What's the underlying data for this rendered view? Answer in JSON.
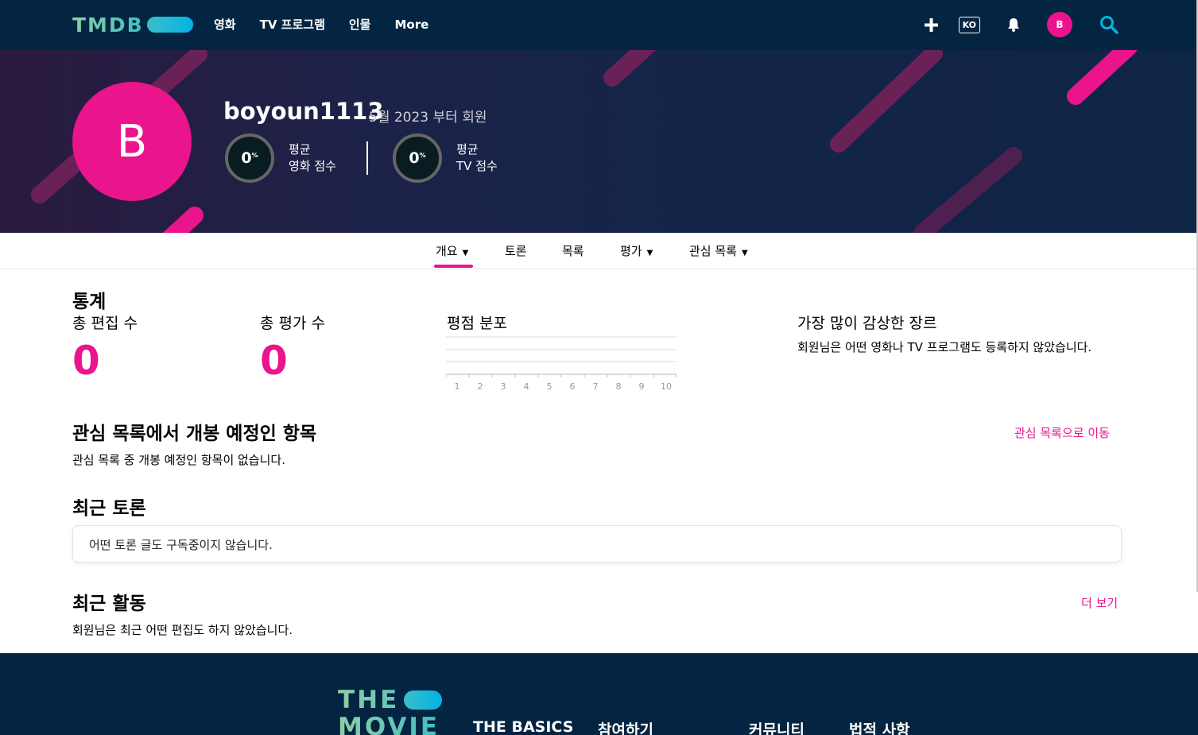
{
  "nav": {
    "logo": "TMDB",
    "links": [
      "영화",
      "TV 프로그램",
      "인물",
      "More"
    ],
    "add_icon": "plus-icon",
    "language": "KO",
    "bell_icon": "bell-icon",
    "avatar_letter": "B",
    "search_icon": "search-icon"
  },
  "profile": {
    "avatar_letter": "B",
    "username": "boyoun1113",
    "member_since": "5월 2023 부터 회원",
    "movie_score": {
      "value": "0",
      "unit": "%",
      "label_line1": "평균",
      "label_line2": "영화 점수"
    },
    "tv_score": {
      "value": "0",
      "unit": "%",
      "label_line1": "평균",
      "label_line2": "TV 점수"
    }
  },
  "tabs": [
    {
      "label": "개요",
      "dropdown": true,
      "active": true
    },
    {
      "label": "토론",
      "dropdown": false
    },
    {
      "label": "목록",
      "dropdown": false
    },
    {
      "label": "평가",
      "dropdown": true
    },
    {
      "label": "관심 목록",
      "dropdown": true
    }
  ],
  "stats": {
    "title": "통계",
    "total_edits_label": "총 편집 수",
    "total_edits_value": "0",
    "total_ratings_label": "총 평가 수",
    "total_ratings_value": "0",
    "rating_distribution_title": "평점 분포",
    "genre_title": "가장 많이 감상한 장르",
    "genre_text": "회원님은 어떤 영화나 TV 프로그램도 등록하지 않았습니다."
  },
  "chart_data": {
    "type": "bar",
    "title": "평점 분포",
    "categories": [
      "1",
      "2",
      "3",
      "4",
      "5",
      "6",
      "7",
      "8",
      "9",
      "10"
    ],
    "values": [
      0,
      0,
      0,
      0,
      0,
      0,
      0,
      0,
      0,
      0
    ],
    "grid": true
  },
  "upcoming": {
    "title": "관심 목록에서 개봉 예정인 항목",
    "text": "관심 목록 중 개봉 예정인 항목이 없습니다.",
    "link": "관심 목록으로 이동"
  },
  "discussions": {
    "title": "최근 토론",
    "text": "어떤 토론 글도 구독중이지 않습니다."
  },
  "activity": {
    "title": "최근 활동",
    "text": "회원님은 최근 어떤 편집도 하지 않았습니다.",
    "link": "더 보기"
  },
  "footer": {
    "logo_line1": "THE",
    "logo_line2": "MOVIE",
    "headings": [
      "THE BASICS",
      "참여하기",
      "커뮤니티",
      "법적 사항"
    ]
  },
  "colors": {
    "navy": "#032541",
    "pink": "#ea148c",
    "teal": "#01b4e4",
    "green": "#90cea1"
  }
}
